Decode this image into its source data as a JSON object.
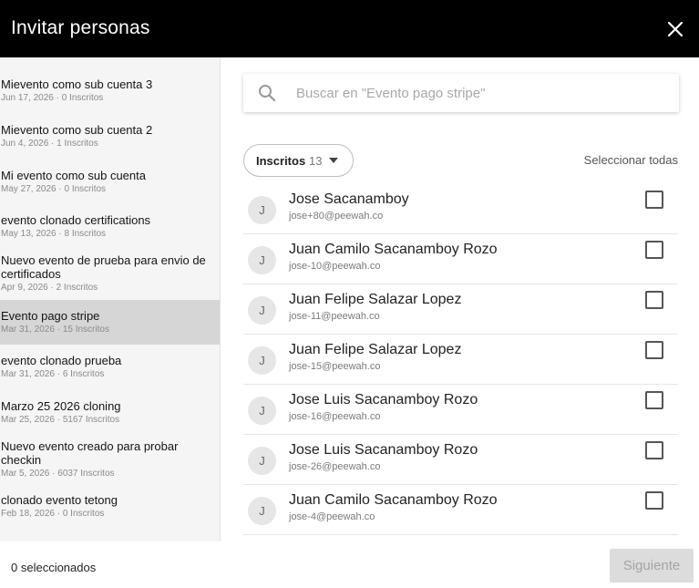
{
  "header": {
    "title": "Invitar personas",
    "close_icon": "close-icon"
  },
  "sidebar": {
    "events": [
      {
        "name": "Mievento como sub cuenta 3",
        "meta": "Jun 17, 2026 · 0 Inscritos"
      },
      {
        "name": "Mievento como sub cuenta 2",
        "meta": "Jun 4, 2026 · 1 Inscritos"
      },
      {
        "name": "Mi evento como sub cuenta",
        "meta": "May 27, 2026 · 0 Inscritos"
      },
      {
        "name": "evento clonado certifications",
        "meta": "May 13, 2026 · 8 Inscritos"
      },
      {
        "name": "Nuevo evento de prueba para envio de certificados",
        "meta": "Apr 9, 2026 · 2 Inscritos"
      },
      {
        "name": "Evento pago stripe",
        "meta": "Mar 31, 2026 · 15 Inscritos",
        "selected": true
      },
      {
        "name": "evento clonado prueba",
        "meta": "Mar 31, 2026 · 6 Inscritos"
      },
      {
        "name": "Marzo 25 2026 cloning",
        "meta": "Mar 25, 2026 · 5167 Inscritos"
      },
      {
        "name": "Nuevo evento creado para probar checkin",
        "meta": "Mar 5, 2026 · 6037 Inscritos"
      },
      {
        "name": "clonado evento tetong",
        "meta": "Feb 18, 2026 · 0 Inscritos"
      }
    ]
  },
  "search": {
    "placeholder": "Buscar en \"Evento pago stripe\"",
    "value": ""
  },
  "filter": {
    "label": "Inscritos",
    "count": "13"
  },
  "select_all": "Seleccionar todas",
  "people": [
    {
      "initial": "J",
      "name": "Jose Sacanamboy",
      "email": "jose+80@peewah.co"
    },
    {
      "initial": "J",
      "name": "Juan Camilo Sacanamboy Rozo",
      "email": "jose-10@peewah.co"
    },
    {
      "initial": "J",
      "name": "Juan Felipe Salazar Lopez",
      "email": "jose-11@peewah.co"
    },
    {
      "initial": "J",
      "name": "Juan Felipe Salazar Lopez",
      "email": "jose-15@peewah.co"
    },
    {
      "initial": "J",
      "name": "Jose Luis Sacanamboy Rozo",
      "email": "jose-16@peewah.co"
    },
    {
      "initial": "J",
      "name": "Jose Luis Sacanamboy Rozo",
      "email": "jose-26@peewah.co"
    },
    {
      "initial": "J",
      "name": "Juan Camilo Sacanamboy Rozo",
      "email": "jose-4@peewah.co"
    }
  ],
  "footer": {
    "selected_count": "0 seleccionados",
    "next_label": "Siguiente"
  },
  "colors": {
    "header_bg": "#000000",
    "sidebar_bg": "#f5f5f5",
    "selected_bg": "#d6d6d6",
    "disabled_button": "#dcdcdc"
  }
}
